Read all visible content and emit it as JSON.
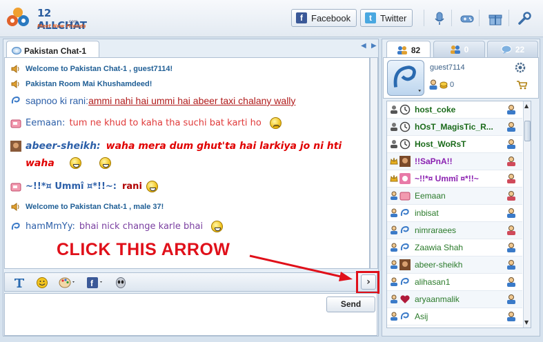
{
  "app": {
    "logo_name": "12 ALLCHAT",
    "logo_domain": ".com",
    "logo_tagline": "Meet New Friends"
  },
  "header": {
    "facebook_label": "Facebook",
    "twitter_label": "Twitter",
    "icons": [
      "microphone-icon",
      "gamepad-icon",
      "gift-icon",
      "wrench-icon"
    ]
  },
  "chat": {
    "tab_label": "Pakistan Chat-1",
    "messages": [
      {
        "type": "system",
        "text": "Welcome to Pakistan Chat-1 , guest7114!"
      },
      {
        "type": "system",
        "text": "Pakistan Room Mai Khushamdeed!"
      },
      {
        "type": "user",
        "name": "sapnoo ki rani:",
        "text": " ammi nahi hai ummi hai abeer taxi chalany wally",
        "name_color": "#2c5fa8",
        "text_color": "#b01a1a"
      },
      {
        "type": "user",
        "name": "Eemaan:",
        "text": "tum ne khud to kaha tha suchi bat karti ho",
        "name_color": "#2c5fa8",
        "text_color": "#e03a3a"
      },
      {
        "type": "user",
        "name": "abeer-sheikh:",
        "text": "waha mera dum ghut'ta hai larkiya jo ni hti",
        "text_cont": "waha",
        "name_color": "#2c5fa8",
        "text_color": "#e00000"
      },
      {
        "type": "user",
        "name": "~!!*¤ Ummî ¤*!!~:",
        "text": "rani",
        "name_color": "#2c5fa8",
        "text_color": "#b00000"
      },
      {
        "type": "system",
        "text": "Welcome to Pakistan Chat-1 , male 37!"
      },
      {
        "type": "user",
        "name": "hamMmYy:",
        "text": "bhai nick change karle bhai",
        "name_color": "#2c5fa8",
        "text_color": "#7a3fa0"
      }
    ],
    "send_label": "Send",
    "send_arrow": "›",
    "callout": "CLICK THIS ARROW",
    "toolbar_icons": [
      "text-format-icon",
      "smiley-icon",
      "palette-icon",
      "facebook-share-icon",
      "alien-icon"
    ]
  },
  "sidebar": {
    "tabs": [
      {
        "label": "82",
        "icon": "users-icon"
      },
      {
        "label": "0",
        "icon": "friends-icon"
      },
      {
        "label": "22",
        "icon": "chat-bubble-icon"
      }
    ],
    "me": {
      "name": "guest7114",
      "coins": "0"
    },
    "users": [
      {
        "name": "host_coke",
        "color": "#1a6a1a",
        "bold": true,
        "gender": "male"
      },
      {
        "name": "hOsT_MagisTic_R...",
        "color": "#1a6a1a",
        "bold": true,
        "gender": "male"
      },
      {
        "name": "Host_WoRsT",
        "color": "#1a6a1a",
        "bold": true,
        "gender": "male"
      },
      {
        "name": "!!SaPnA!!",
        "color": "#8a1fb0",
        "bold": true,
        "gender": "female"
      },
      {
        "name": "~!!*¤ Ummî ¤*!!~",
        "color": "#8a1fb0",
        "bold": true,
        "gender": "female"
      },
      {
        "name": "Eemaan",
        "color": "#2a7a2a",
        "bold": false,
        "gender": "female"
      },
      {
        "name": "inbisat",
        "color": "#2a7a2a",
        "bold": false,
        "gender": "male"
      },
      {
        "name": "nimraraees",
        "color": "#2a7a2a",
        "bold": false,
        "gender": "female"
      },
      {
        "name": "Zaawia Shah",
        "color": "#2a7a2a",
        "bold": false,
        "gender": "male"
      },
      {
        "name": "abeer-sheikh",
        "color": "#2a7a2a",
        "bold": false,
        "gender": "male"
      },
      {
        "name": "alihasan1",
        "color": "#2a7a2a",
        "bold": false,
        "gender": "male"
      },
      {
        "name": "aryaanmalik",
        "color": "#2a7a2a",
        "bold": false,
        "gender": "male"
      },
      {
        "name": "Asij",
        "color": "#2a7a2a",
        "bold": false,
        "gender": "male"
      }
    ]
  }
}
